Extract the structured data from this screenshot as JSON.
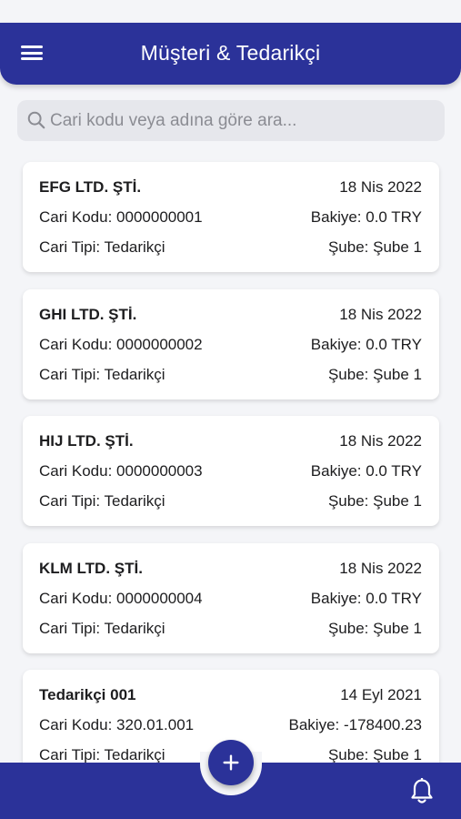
{
  "header": {
    "title": "Müşteri & Tedarikçi",
    "menu_icon": "hamburger-menu-icon"
  },
  "search": {
    "placeholder": "Cari kodu veya adına göre ara...",
    "value": "",
    "icon": "search-icon"
  },
  "cards": [
    {
      "name": "EFG LTD. ŞTİ.",
      "date": "18 Nis 2022",
      "code": "Cari Kodu: 0000000001",
      "balance": "Bakiye: 0.0 TRY",
      "type": "Cari Tipi: Tedarikçi",
      "branch": "Şube: Şube 1"
    },
    {
      "name": "GHI LTD. ŞTİ.",
      "date": "18 Nis 2022",
      "code": "Cari Kodu: 0000000002",
      "balance": "Bakiye: 0.0 TRY",
      "type": "Cari Tipi: Tedarikçi",
      "branch": "Şube: Şube 1"
    },
    {
      "name": "HIJ LTD. ŞTİ.",
      "date": "18 Nis 2022",
      "code": "Cari Kodu: 0000000003",
      "balance": "Bakiye: 0.0 TRY",
      "type": "Cari Tipi: Tedarikçi",
      "branch": "Şube: Şube 1"
    },
    {
      "name": "KLM LTD. ŞTİ.",
      "date": "18 Nis 2022",
      "code": "Cari Kodu: 0000000004",
      "balance": "Bakiye: 0.0 TRY",
      "type": "Cari Tipi: Tedarikçi",
      "branch": "Şube: Şube 1"
    },
    {
      "name": "Tedarikçi 001",
      "date": "14 Eyl 2021",
      "code": "Cari Kodu: 320.01.001",
      "balance": "Bakiye: -178400.23",
      "type": "Cari Tipi: Tedarikçi",
      "branch": "Şube: Şube 1"
    }
  ],
  "bottom_bar": {
    "fab_icon": "plus-icon",
    "bell_icon": "bell-icon"
  },
  "colors": {
    "primary": "#2b3299",
    "background": "#f4f5f8",
    "card": "#ffffff",
    "search_bg": "#e6e7ec",
    "placeholder": "#8b8c93"
  }
}
